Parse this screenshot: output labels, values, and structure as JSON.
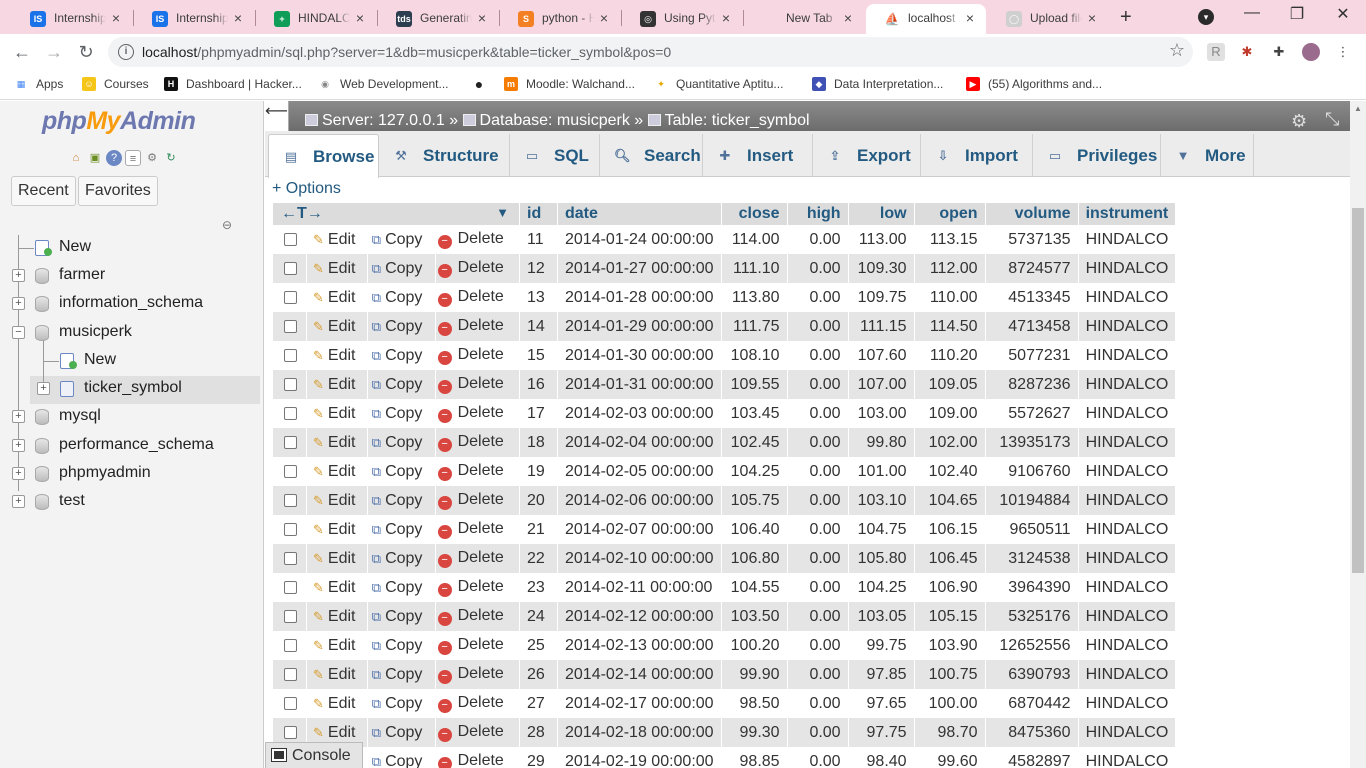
{
  "browser": {
    "tabs": [
      {
        "label": "Internships",
        "fav": "IS",
        "favcolor": "#1a73e8"
      },
      {
        "label": "Internship",
        "fav": "IS",
        "favcolor": "#1a73e8"
      },
      {
        "label": "HINDALCO",
        "fav": "+",
        "favcolor": "#0f9d58"
      },
      {
        "label": "Generating",
        "fav": "tds",
        "favcolor": "#2c3e50"
      },
      {
        "label": "python - H",
        "fav": "S",
        "favcolor": "#f48024"
      },
      {
        "label": "Using Pyth",
        "fav": "◎",
        "favcolor": "#333333"
      },
      {
        "label": "New Tab",
        "fav": "",
        "favcolor": "transparent"
      },
      {
        "label": "localhost /",
        "fav": "pma",
        "favcolor": "#f89c0e"
      },
      {
        "label": "Upload file",
        "fav": "◯",
        "favcolor": "#cfcfcf"
      }
    ],
    "url_host": "localhost",
    "url_path": "/phpmyadmin/sql.php?server=1&db=musicperk&table=ticker_symbol&pos=0",
    "bookmarks": [
      {
        "label": "Apps",
        "icon": "apps-icon"
      },
      {
        "label": "Courses",
        "icon": "courses-icon"
      },
      {
        "label": "Dashboard | Hacker...",
        "icon": "hackerrank-icon"
      },
      {
        "label": "Web Development...",
        "icon": "webdev-icon"
      },
      {
        "label": "",
        "icon": "globe-icon"
      },
      {
        "label": "Moodle: Walchand...",
        "icon": "moodle-icon"
      },
      {
        "label": "Quantitative Aptitu...",
        "icon": "quant-icon"
      },
      {
        "label": "Data Interpretation...",
        "icon": "di-icon"
      },
      {
        "label": "(55) Algorithms and...",
        "icon": "youtube-icon"
      }
    ]
  },
  "sidebar": {
    "logo_php": "php",
    "logo_my": "My",
    "logo_admin": "Admin",
    "recent": "Recent",
    "favorites": "Favorites",
    "tree": [
      {
        "label": "New",
        "level": 0,
        "expander": ""
      },
      {
        "label": "farmer",
        "level": 0,
        "expander": "+"
      },
      {
        "label": "information_schema",
        "level": 0,
        "expander": "+"
      },
      {
        "label": "musicperk",
        "level": 0,
        "expander": "−"
      },
      {
        "label": "New",
        "level": 1,
        "expander": ""
      },
      {
        "label": "ticker_symbol",
        "level": 1,
        "expander": "+"
      },
      {
        "label": "mysql",
        "level": 0,
        "expander": "+"
      },
      {
        "label": "performance_schema",
        "level": 0,
        "expander": "+"
      },
      {
        "label": "phpmyadmin",
        "level": 0,
        "expander": "+"
      },
      {
        "label": "test",
        "level": 0,
        "expander": "+"
      }
    ]
  },
  "breadcrumb": {
    "server": "Server: 127.0.0.1",
    "database": "Database: musicperk",
    "table": "Table: ticker_symbol"
  },
  "menu": [
    {
      "label": "Browse",
      "icon": "browse-icon"
    },
    {
      "label": "Structure",
      "icon": "structure-icon"
    },
    {
      "label": "SQL",
      "icon": "sql-icon"
    },
    {
      "label": "Search",
      "icon": "search-icon"
    },
    {
      "label": "Insert",
      "icon": "insert-icon"
    },
    {
      "label": "Export",
      "icon": "export-icon"
    },
    {
      "label": "Import",
      "icon": "import-icon"
    },
    {
      "label": "Privileges",
      "icon": "privileges-icon"
    },
    {
      "label": "More",
      "icon": "more-icon"
    }
  ],
  "options_label": "+ Options",
  "actions": {
    "edit": "Edit",
    "copy": "Copy",
    "delete": "Delete"
  },
  "table": {
    "columns": [
      "id",
      "date",
      "close",
      "high",
      "low",
      "open",
      "volume",
      "instrument"
    ],
    "rows": [
      [
        "11",
        "2014-01-24 00:00:00",
        "114.00",
        "0.00",
        "113.00",
        "113.15",
        "5737135",
        "HINDALCO"
      ],
      [
        "12",
        "2014-01-27 00:00:00",
        "111.10",
        "0.00",
        "109.30",
        "112.00",
        "8724577",
        "HINDALCO"
      ],
      [
        "13",
        "2014-01-28 00:00:00",
        "113.80",
        "0.00",
        "109.75",
        "110.00",
        "4513345",
        "HINDALCO"
      ],
      [
        "14",
        "2014-01-29 00:00:00",
        "111.75",
        "0.00",
        "111.15",
        "114.50",
        "4713458",
        "HINDALCO"
      ],
      [
        "15",
        "2014-01-30 00:00:00",
        "108.10",
        "0.00",
        "107.60",
        "110.20",
        "5077231",
        "HINDALCO"
      ],
      [
        "16",
        "2014-01-31 00:00:00",
        "109.55",
        "0.00",
        "107.00",
        "109.05",
        "8287236",
        "HINDALCO"
      ],
      [
        "17",
        "2014-02-03 00:00:00",
        "103.45",
        "0.00",
        "103.00",
        "109.00",
        "5572627",
        "HINDALCO"
      ],
      [
        "18",
        "2014-02-04 00:00:00",
        "102.45",
        "0.00",
        "99.80",
        "102.00",
        "13935173",
        "HINDALCO"
      ],
      [
        "19",
        "2014-02-05 00:00:00",
        "104.25",
        "0.00",
        "101.00",
        "102.40",
        "9106760",
        "HINDALCO"
      ],
      [
        "20",
        "2014-02-06 00:00:00",
        "105.75",
        "0.00",
        "103.10",
        "104.65",
        "10194884",
        "HINDALCO"
      ],
      [
        "21",
        "2014-02-07 00:00:00",
        "106.40",
        "0.00",
        "104.75",
        "106.15",
        "9650511",
        "HINDALCO"
      ],
      [
        "22",
        "2014-02-10 00:00:00",
        "106.80",
        "0.00",
        "105.80",
        "106.45",
        "3124538",
        "HINDALCO"
      ],
      [
        "23",
        "2014-02-11 00:00:00",
        "104.55",
        "0.00",
        "104.25",
        "106.90",
        "3964390",
        "HINDALCO"
      ],
      [
        "24",
        "2014-02-12 00:00:00",
        "103.50",
        "0.00",
        "103.05",
        "105.15",
        "5325176",
        "HINDALCO"
      ],
      [
        "25",
        "2014-02-13 00:00:00",
        "100.20",
        "0.00",
        "99.75",
        "103.90",
        "12652556",
        "HINDALCO"
      ],
      [
        "26",
        "2014-02-14 00:00:00",
        "99.90",
        "0.00",
        "97.85",
        "100.75",
        "6390793",
        "HINDALCO"
      ],
      [
        "27",
        "2014-02-17 00:00:00",
        "98.50",
        "0.00",
        "97.65",
        "100.00",
        "6870442",
        "HINDALCO"
      ],
      [
        "28",
        "2014-02-18 00:00:00",
        "99.30",
        "0.00",
        "97.75",
        "98.70",
        "8475360",
        "HINDALCO"
      ],
      [
        "29",
        "2014-02-19 00:00:00",
        "98.85",
        "0.00",
        "98.40",
        "99.60",
        "4582897",
        "HINDALCO"
      ]
    ]
  },
  "console_label": "Console"
}
